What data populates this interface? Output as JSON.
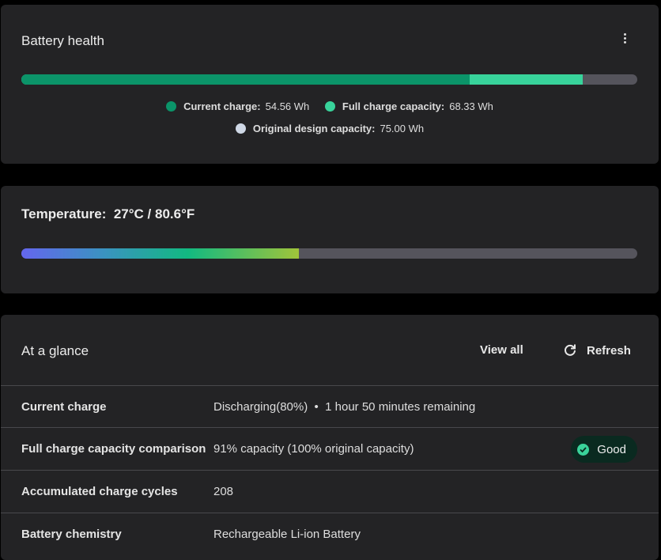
{
  "battery_health": {
    "title": "Battery health",
    "more_icon": "more-vertical-icon",
    "design_capacity_wh": 75.0,
    "current_charge_wh": 54.56,
    "full_charge_wh": 68.33,
    "colors": {
      "current": "#0b9469",
      "full": "#38d39b",
      "design": "#cfd8e6",
      "track": "#55545c"
    },
    "legend": {
      "current_label": "Current charge:",
      "current_value": "54.56 Wh",
      "full_label": "Full charge capacity:",
      "full_value": "68.33 Wh",
      "design_label": "Original design capacity:",
      "design_value": "75.00 Wh"
    }
  },
  "temperature": {
    "label": "Temperature:",
    "value": "27°C / 80.6°F",
    "level_percent": 45
  },
  "at_a_glance": {
    "title": "At a glance",
    "view_all": "View all",
    "refresh": "Refresh",
    "rows": [
      {
        "key": "Current charge",
        "value": "Discharging(80%)  •  1 hour 50 minutes remaining"
      },
      {
        "key": "Full charge capacity comparison",
        "value": "91% capacity (100% original capacity)",
        "badge": "Good"
      },
      {
        "key": "Accumulated charge cycles",
        "value": "208"
      },
      {
        "key": "Battery chemistry",
        "value": "Rechargeable Li-ion Battery"
      }
    ]
  }
}
